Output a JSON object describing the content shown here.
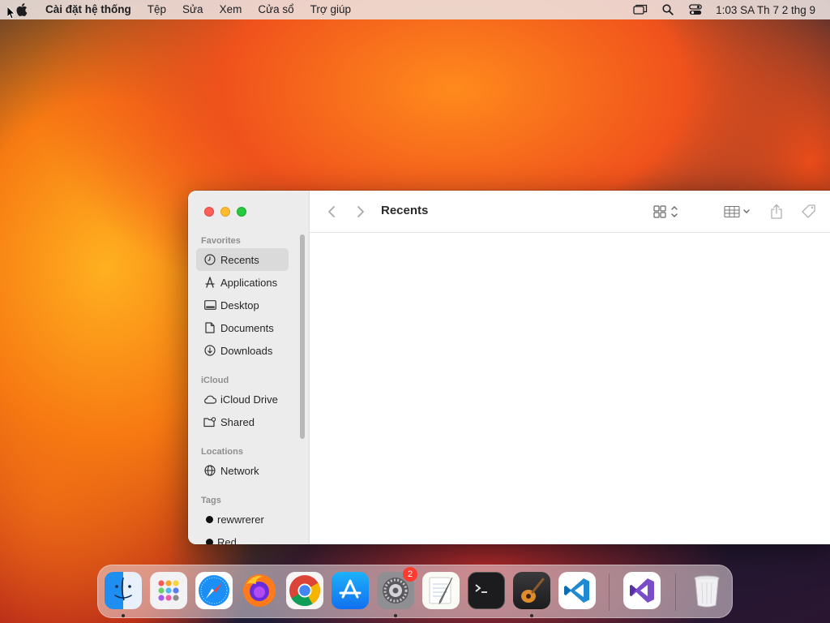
{
  "menubar": {
    "app_name": "Cài đặt hệ thống",
    "menus": [
      "Tệp",
      "Sửa",
      "Xem",
      "Cửa sổ",
      "Trợ giúp"
    ],
    "clock": "1:03 SA Th 7 2 thg 9"
  },
  "finder": {
    "title": "Recents",
    "sidebar": {
      "favorites_label": "Favorites",
      "favorites": [
        "Recents",
        "Applications",
        "Desktop",
        "Documents",
        "Downloads"
      ],
      "icloud_label": "iCloud",
      "icloud": [
        "iCloud Drive",
        "Shared"
      ],
      "locations_label": "Locations",
      "locations": [
        "Network"
      ],
      "tags_label": "Tags",
      "tags": [
        "rewwrerer",
        "Red"
      ]
    }
  },
  "dock": {
    "apps": [
      "Finder",
      "Launchpad",
      "Safari",
      "Firefox",
      "Chrome",
      "App Store",
      "System Settings",
      "TextEdit",
      "Terminal",
      "GarageBand",
      "Visual Studio Code",
      "Visual Studio",
      "Trash"
    ],
    "settings_badge": "2"
  },
  "colors": {
    "close": "#ff5f57",
    "minimize": "#febc2e",
    "maximize": "#28c840",
    "badge": "#ff3b30"
  }
}
